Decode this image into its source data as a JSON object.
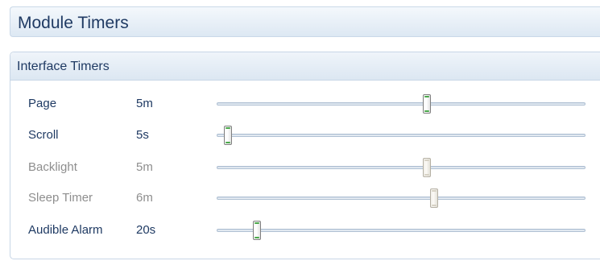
{
  "title": "Module Timers",
  "group": {
    "title": "Interface Timers",
    "rows": [
      {
        "label": "Page",
        "value": "5m",
        "enabled": true,
        "level": 0.57
      },
      {
        "label": "Scroll",
        "value": "5s",
        "enabled": true,
        "level": 0.03
      },
      {
        "label": "Backlight",
        "value": "5m",
        "enabled": false,
        "level": 0.57
      },
      {
        "label": "Sleep Timer",
        "value": "6m",
        "enabled": false,
        "level": 0.59
      },
      {
        "label": "Audible Alarm",
        "value": "20s",
        "enabled": true,
        "level": 0.11
      }
    ]
  },
  "colors": {
    "text_enabled": "#1f3a63",
    "text_disabled": "#8e8e8e",
    "thumb_accent": "#4aa84a"
  }
}
